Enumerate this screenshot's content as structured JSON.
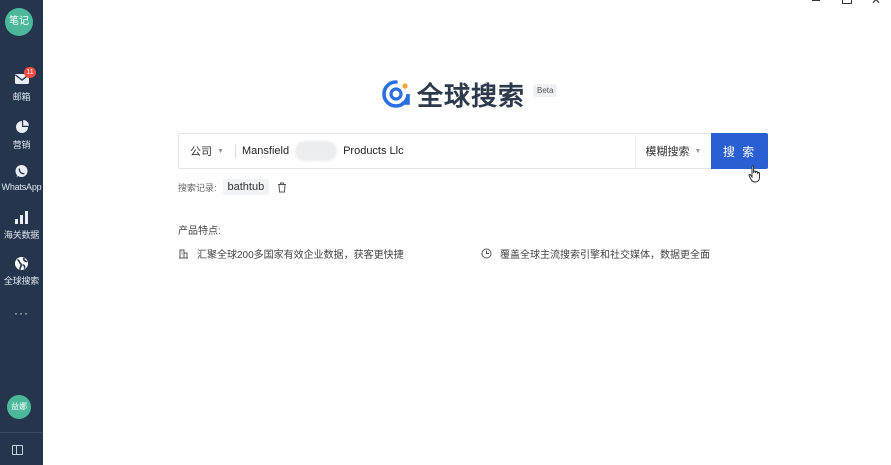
{
  "sidebar": {
    "logo": "笔记",
    "items": [
      {
        "label": "邮箱",
        "icon": "mail-icon",
        "badge": "11"
      },
      {
        "label": "营销",
        "icon": "pie-chart-icon"
      },
      {
        "label": "WhatsApp",
        "icon": "whatsapp-icon"
      },
      {
        "label": "海关数据",
        "icon": "bar-chart-icon"
      },
      {
        "label": "全球搜索",
        "icon": "globe-icon"
      }
    ],
    "more": "···",
    "avatar": "益娜"
  },
  "window": {
    "close": "✕"
  },
  "brand": {
    "title": "全球搜索",
    "beta": "Beta"
  },
  "search": {
    "scope": "公司",
    "query_before": "Mansfield",
    "query_after": "Products Llc",
    "mode": "模糊搜索",
    "button": "搜 索"
  },
  "history": {
    "label": "搜索记录:",
    "items": [
      "bathtub"
    ]
  },
  "features": {
    "title": "产品特点:",
    "items": [
      {
        "icon": "building-icon",
        "text": "汇聚全球200多国家有效企业数据，获客更快捷"
      },
      {
        "icon": "clock-icon",
        "text": "覆盖全球主流搜索引擎和社交媒体，数据更全面"
      }
    ]
  },
  "colors": {
    "sidebar": "#24354d",
    "accent": "#2a5fd4",
    "logo_green": "#4bb89a",
    "badge": "#f04b3e"
  }
}
